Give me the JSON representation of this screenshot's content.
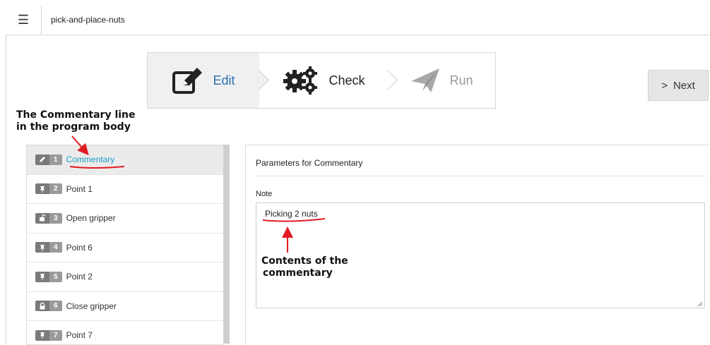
{
  "header": {
    "menu_icon": "hamburger-icon",
    "program_name": "pick-and-place-nuts"
  },
  "steps": [
    {
      "label": "Edit",
      "icon": "edit-icon",
      "state": "active"
    },
    {
      "label": "Check",
      "icon": "gears-icon",
      "state": "normal"
    },
    {
      "label": "Run",
      "icon": "paper-plane-icon",
      "state": "disabled"
    }
  ],
  "next_button": {
    "label": "Next",
    "icon": "chevron-right-icon"
  },
  "annotations": {
    "commentary_line_1": "The Commentary line",
    "commentary_line_2": "in the program body",
    "contents_line_1": "Contents of the",
    "contents_line_2": "commentary",
    "color": "#e11b22"
  },
  "program_lines": [
    {
      "num": "1",
      "icon": "pencil-icon",
      "label": "Commentary",
      "selected": true
    },
    {
      "num": "2",
      "icon": "pin-icon",
      "label": "Point 1"
    },
    {
      "num": "3",
      "icon": "unlock-icon",
      "label": "Open gripper"
    },
    {
      "num": "4",
      "icon": "pin-icon",
      "label": "Point 6"
    },
    {
      "num": "5",
      "icon": "pin-icon",
      "label": "Point 2"
    },
    {
      "num": "6",
      "icon": "lock-icon",
      "label": "Close gripper"
    },
    {
      "num": "7",
      "icon": "pin-icon",
      "label": "Point 7"
    }
  ],
  "parameters": {
    "title": "Parameters for  Commentary",
    "note_label": "Note",
    "note_value": "Picking 2 nuts"
  },
  "colors": {
    "accent": "#2a6fb0",
    "selected_text": "#1a9fc8",
    "annotation": "#e11b22"
  }
}
